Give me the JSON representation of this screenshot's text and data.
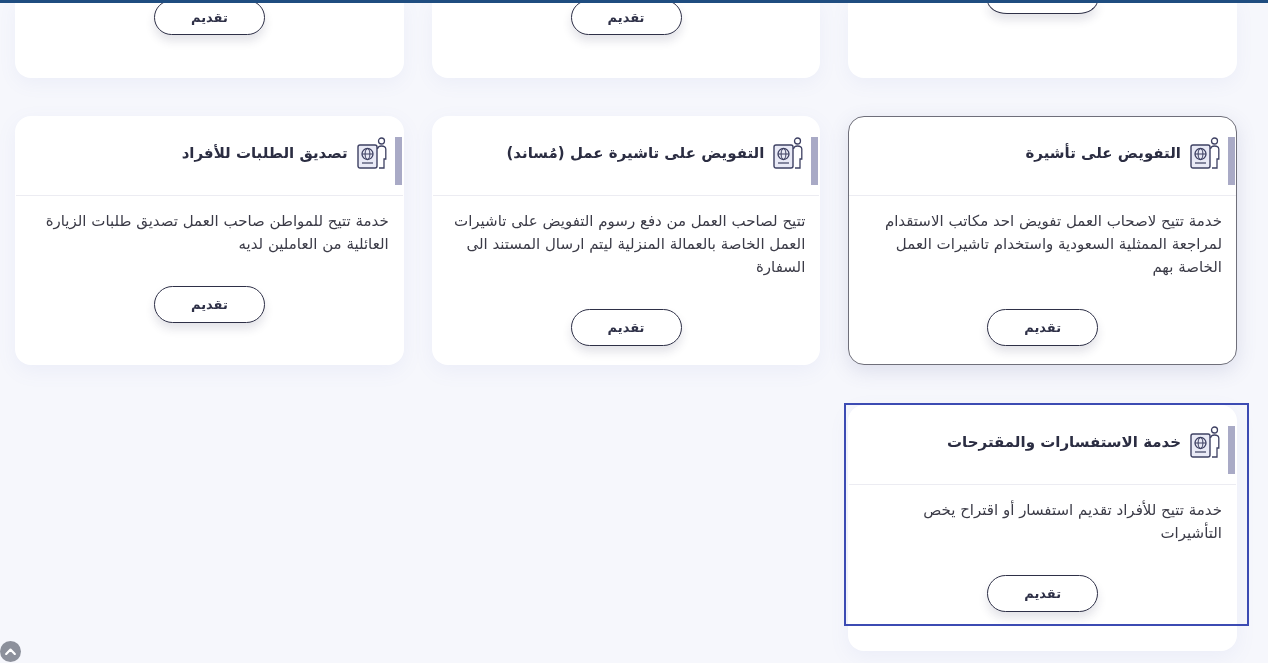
{
  "top_row": [
    {
      "kind": "clipped"
    },
    {
      "kind": "labelled",
      "button": "تقديم"
    },
    {
      "kind": "labelled",
      "button": "تقديم"
    }
  ],
  "services": [
    {
      "title": "التفويض على تأشيرة",
      "description": "خدمة تتيح لاصحاب العمل تفويض احد مكاتب الاستقدام لمراجعة الممثلية السعودية واستخدام تاشيرات العمل الخاصة بهم",
      "button": "تقديم",
      "hovered": true,
      "focused": false
    },
    {
      "title": "التفويض على تاشيرة عمل (مُساند)",
      "description": "تتيح لصاحب العمل من دفع رسوم التفويض على تاشيرات العمل الخاصة بالعمالة المنزلية ليتم ارسال المستند الى السفارة",
      "button": "تقديم",
      "hovered": false,
      "focused": false
    },
    {
      "title": "تصديق الطلبات للأفراد",
      "description": "خدمة تتيح للمواطن صاحب العمل تصديق طلبات الزيارة العائلية من العاملين لديه",
      "button": "تقديم",
      "hovered": false,
      "focused": false
    },
    {
      "title": "خدمة الاستفسارات والمقترحات",
      "description": "خدمة تتيح للأفراد تقديم استفسار أو اقتراح يخص التأشيرات",
      "button": "تقديم",
      "hovered": false,
      "focused": true
    }
  ]
}
